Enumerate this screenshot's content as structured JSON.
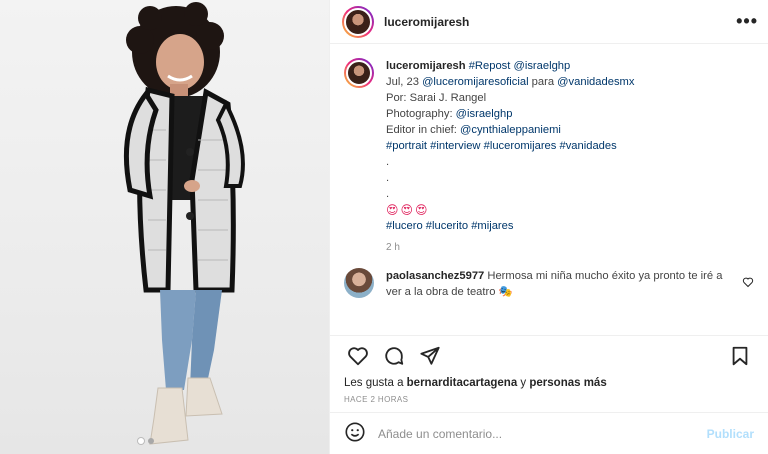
{
  "post": {
    "username": "luceromijaresh",
    "more_glyph": "•••",
    "photo": {
      "description_icon": "woman-portrait-photo",
      "carousel_total": 2,
      "carousel_active": 1
    }
  },
  "caption": {
    "username": "luceromijaresh",
    "line1_tags": "#Repost @israelghp",
    "line2_a": "Jul, 23 ",
    "line2_tag1": "@luceromijaresoficial",
    "line2_mid": " para ",
    "line2_tag2": "@vanidadesmx",
    "line3": "Por: Sarai J. Rangel",
    "line4_a": "Photography: ",
    "line4_tag": "@israelghp",
    "line5_a": "Editor in chief: ",
    "line5_tag": "@cynthialeppaniemi",
    "line6_tags": "#portrait #interview #luceromijares #vanidades",
    "dot1": ".",
    "dot2": ".",
    "dot3": ".",
    "emojis": "😍😍😍",
    "line8_tags": "#lucero #lucerito #mijares",
    "time": "2 h"
  },
  "comment": {
    "username": "paolasanchez5977",
    "text": "Hermosa mi niña mucho éxito ya pronto te iré a ver a la obra de teatro 🎭"
  },
  "likes": {
    "prefix": "Les gusta a ",
    "user": "bernarditacartagena",
    "suffix": " y ",
    "others": "personas más"
  },
  "ago": "HACE 2 HORAS",
  "add_comment": {
    "placeholder": "Añade un comentario...",
    "publish_label": "Publicar"
  }
}
